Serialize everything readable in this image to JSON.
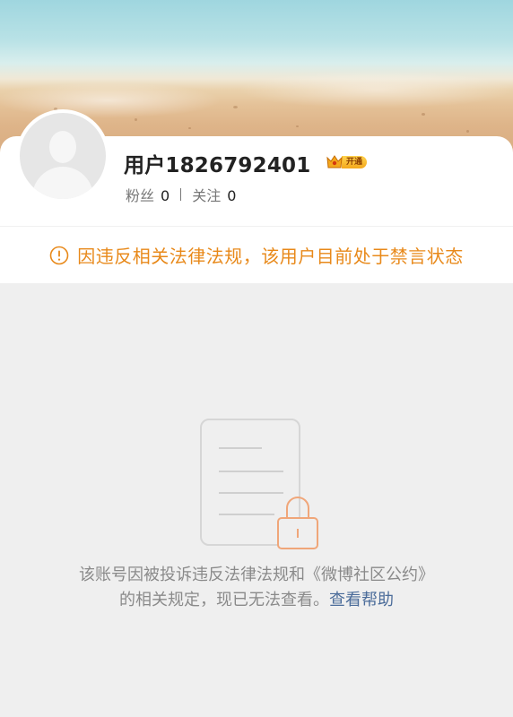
{
  "profile": {
    "username": "用户1826792401",
    "vip_label": "开通",
    "followers_label": "粉丝",
    "followers_count": "0",
    "following_label": "关注",
    "following_count": "0"
  },
  "notice": {
    "text": "因违反相关法律法规，该用户目前处于禁言状态"
  },
  "empty_state": {
    "line1": "该账号因被投诉违反法律法规和《微博社区公约》",
    "line2": "的相关规定，现已无法查看。",
    "help_link": "查看帮助"
  },
  "colors": {
    "notice": "#e8891a",
    "link": "#4b6c9a",
    "lock": "#f0a679",
    "vip": "#f4a81d"
  },
  "icons": [
    "avatar-placeholder",
    "vip-crown-icon",
    "warning-circle-icon",
    "document-icon",
    "lock-icon"
  ]
}
